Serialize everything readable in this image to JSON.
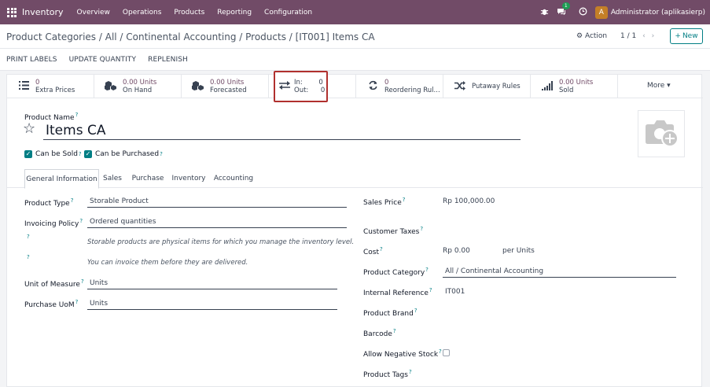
{
  "navbar": {
    "brand": "Inventory",
    "menu": [
      "Overview",
      "Operations",
      "Products",
      "Reporting",
      "Configuration"
    ],
    "chat_count": "1",
    "avatar_letter": "A",
    "user": "Administrator (aplikasierp)"
  },
  "control": {
    "breadcrumb": "Product Categories / All / Continental Accounting / Products / [IT001] Items CA",
    "action_label": "Action",
    "pager": "1 / 1",
    "new_label": "New"
  },
  "statusbar": {
    "buttons": [
      "PRINT LABELS",
      "UPDATE QUANTITY",
      "REPLENISH"
    ]
  },
  "smart_buttons": {
    "extra_prices": {
      "value": "0",
      "label": "Extra Prices"
    },
    "on_hand": {
      "value": "0.00 Units",
      "label": "On Hand"
    },
    "forecasted": {
      "value": "0.00 Units",
      "label": "Forecasted"
    },
    "in_out": {
      "in_label": "In:",
      "in_value": "0",
      "out_label": "Out:",
      "out_value": "0"
    },
    "reordering": {
      "value": "0",
      "label": "Reordering Rul..."
    },
    "putaway": {
      "label": "Putaway Rules"
    },
    "sold": {
      "value": "0.00 Units",
      "label": "Sold"
    },
    "more": "More"
  },
  "product": {
    "name_label": "Product Name",
    "name": "Items CA",
    "can_be_sold": "Can be Sold",
    "can_be_purchased": "Can be Purchased"
  },
  "tabs": [
    "General Information",
    "Sales",
    "Purchase",
    "Inventory",
    "Accounting"
  ],
  "left_fields": {
    "product_type_label": "Product Type",
    "product_type": "Storable Product",
    "invoicing_policy_label": "Invoicing Policy",
    "invoicing_policy": "Ordered quantities",
    "help_type": "Storable products are physical items for which you manage the inventory level.",
    "help_invoice": "You can invoice them before they are delivered.",
    "uom_label": "Unit of Measure",
    "uom": "Units",
    "purchase_uom_label": "Purchase UoM",
    "purchase_uom": "Units"
  },
  "right_fields": {
    "sales_price_label": "Sales Price",
    "sales_price": "Rp 100,000.00",
    "customer_taxes_label": "Customer Taxes",
    "cost_label": "Cost",
    "cost": "Rp 0.00",
    "cost_unit": "per Units",
    "category_label": "Product Category",
    "category": "All / Continental Accounting",
    "internal_ref_label": "Internal Reference",
    "internal_ref": "IT001",
    "brand_label": "Product Brand",
    "barcode_label": "Barcode",
    "allow_negative_label": "Allow Negative Stock",
    "tags_label": "Product Tags"
  }
}
